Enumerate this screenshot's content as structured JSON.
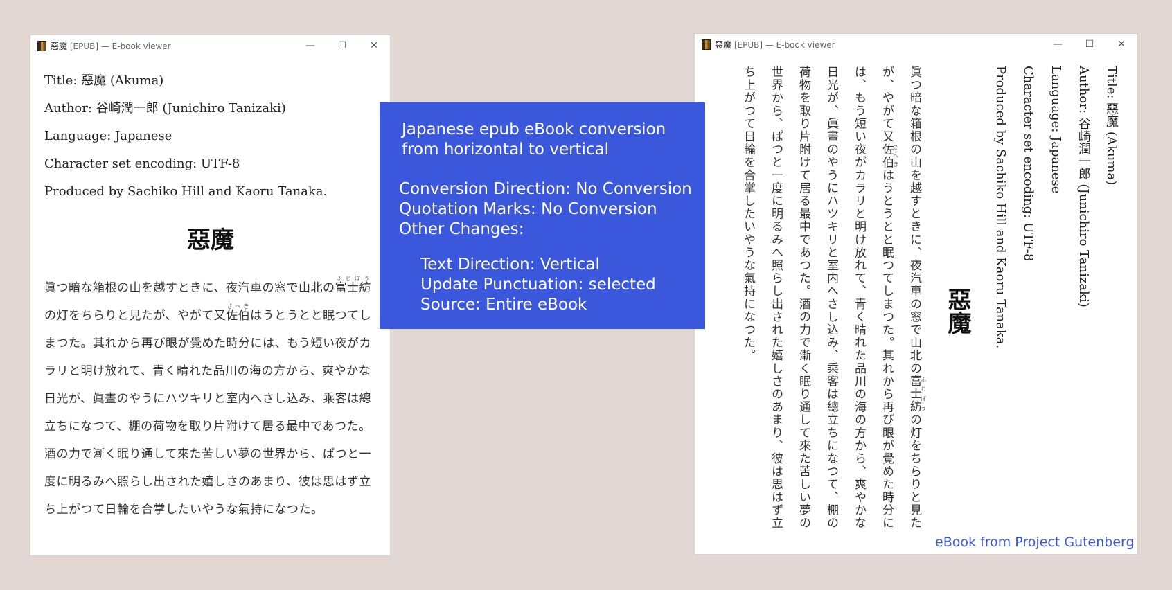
{
  "window_left": {
    "title": "惡魔",
    "title_meta": " [EPUB] — E-book viewer",
    "controls": {
      "minimize": "—",
      "maximize": "☐",
      "close": "✕"
    },
    "metadata": [
      "Title: 惡魔 (Akuma)",
      "Author: 谷崎潤一郎 (Junichiro Tanizaki)",
      "Language: Japanese",
      "Character set encoding: UTF-8",
      "Produced by Sachiko Hill and Kaoru Tanaka."
    ],
    "book_title": "惡魔",
    "body": {
      "t1": "眞つ暗な箱根の山を越すときに、夜汽車の窓で山北の",
      "r1_base": "富士紡",
      "r1_rt": "ふじぼう",
      "t2": "の灯をちらりと見たが、やがて又",
      "r2_base": "佐伯",
      "r2_rt": "さへき",
      "t3": "はうとうとと眠つてしまつた。其れから再び眼が覺めた時分には、もう短い夜がカラリと明け放れて、青く晴れた品川の海の方から、爽やかな日光が、眞晝のやうにハツキリと室内へさし込み、乘客は總立ちになつて、棚の荷物を取り片附けて居る最中であつた。酒の力で漸く眠り通して來た苦しい夢の世界から、ぱつと一度に明るみへ照らし出された嬉しさのあまり、彼は思はず立ち上がつて日輪を合掌したいやうな氣持になつた。"
    }
  },
  "window_right": {
    "title": "惡魔",
    "title_meta": " [EPUB] — E-book viewer",
    "controls": {
      "minimize": "—",
      "maximize": "☐",
      "close": "✕"
    },
    "metadata": [
      "Title: 惡魔 (Akuma)",
      "Author: 谷崎潤一郎 (Junichiro Tanizaki)",
      "Language: Japanese",
      "Character set encoding: UTF-8",
      "Produced by Sachiko Hill and Kaoru Tanaka."
    ],
    "book_title": "惡魔",
    "body": {
      "t1": "眞つ暗な箱根の山を越すときに、夜汽車の窓で山北の",
      "r1_base": "富士紡",
      "r1_rt": "ふじぼう",
      "t2": "の灯をちらりと見たが、やがて又",
      "r2_base": "佐伯",
      "r2_rt": "さへき",
      "t3": "はうとうとと眠つてしまつた。其れから再び眼が覺めた時分には、もう短い夜がカラリと明け放れて、青く晴れた品川の海の方から、爽やかな日光が、眞晝のやうにハツキリと室内へさし込み、乘客は總立ちになつて、棚の荷物を取り片附けて居る最中であつた。酒の力で漸く眠り通して來た苦しい夢の世界から、ぱつと一度に明るみへ照らし出された嬉しさのあまり、彼は思はず立ち上がつて日輪を合掌したいやうな氣持になつた。"
    }
  },
  "info": {
    "heading": "Japanese epub eBook conversion from horizontal to vertical",
    "conversion_direction": "Conversion Direction: No Conversion",
    "quotation_marks": "Quotation Marks: No Conversion",
    "other_changes": "Other Changes:",
    "text_direction": "Text Direction: Vertical",
    "update_punctuation": "Update Punctuation: selected",
    "source": "Source: Entire eBook"
  },
  "footer": "eBook from Project Gutenberg",
  "colors": {
    "background": "#e2d7d2",
    "info_box": "#3b57dc",
    "link": "#3a57d8"
  }
}
